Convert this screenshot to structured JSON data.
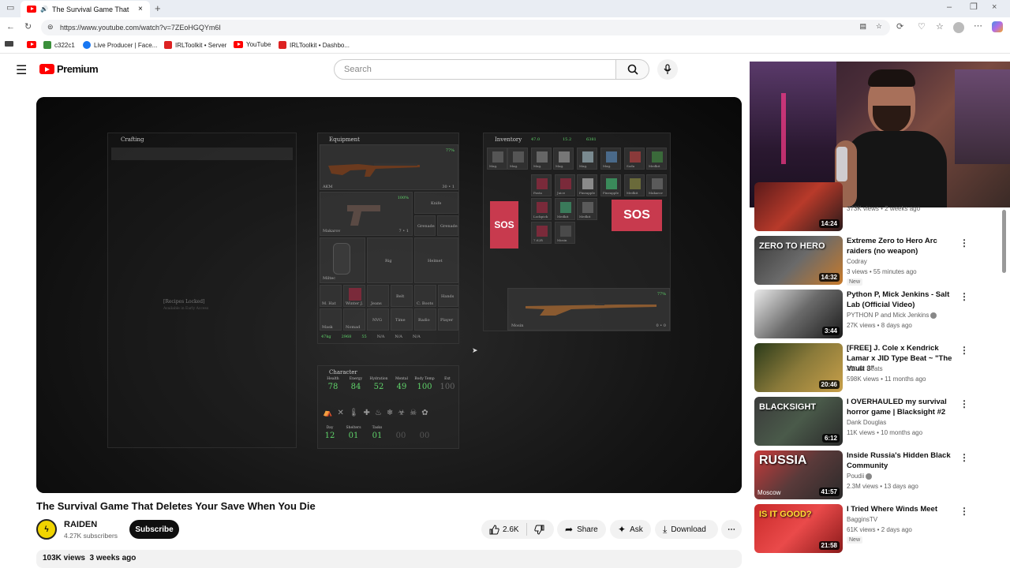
{
  "browser": {
    "tab_title": "The Survival Game That Dele",
    "url": "https://www.youtube.com/watch?v=7ZEoHGQYm6I",
    "bookmarks": [
      "c322c1",
      "Live Producer | Face...",
      "IRLToolkit • Server",
      "YouTube",
      "IRLToolkit • Dashbo..."
    ]
  },
  "header": {
    "logo_text": "Premium",
    "search_placeholder": "Search"
  },
  "game": {
    "crafting_title": "Crafting",
    "recipes_locked": "[Recipes Locked]",
    "recipes_sub": "Available in Early Access",
    "equipment_title": "Equipment",
    "inventory_title": "Inventory",
    "character_title": "Character",
    "inventory_stats": [
      "47.0",
      "15.2",
      "6381"
    ],
    "weapon_primary": "AKM",
    "weapon_primary_ammo": "30 • 1",
    "weapon_primary_condition": "77%",
    "weapon_secondary": "Makarov",
    "weapon_secondary_ammo": "7 • 1",
    "weapon_secondary_condition": "100%",
    "weapon_inventory": "Mosin",
    "weapon_inventory_ammo": "0 • 0",
    "weapon_inventory_condition": "77%",
    "equipment_slots": [
      "Knife",
      "Grenade",
      "Grenade",
      "Rig",
      "Helmet",
      "Belt",
      "C. Boots",
      "Hands",
      "NVG",
      "Time",
      "Radio",
      "Player",
      "Jeans",
      "Winter J.",
      "M. Hat",
      "Nomad",
      "Mask",
      "Miltec"
    ],
    "equipment_footer": [
      "47kg",
      "2968",
      "55",
      "N/A",
      "N/A",
      "N/A"
    ],
    "inventory_items": [
      "Mag.",
      "Mag.",
      "Mag.",
      "Mag.",
      "Mag.",
      "Mag.",
      "Soda",
      "Medkit",
      "Pasta",
      "Juice",
      "Pineapple",
      "Pineapple",
      "Medkit",
      "Makarov",
      "Lockpick",
      "Medkit",
      "Medkit",
      "7.62R",
      "Mosin"
    ],
    "character_stats": [
      {
        "label": "Health",
        "value": "78"
      },
      {
        "label": "Energy",
        "value": "84"
      },
      {
        "label": "Hydration",
        "value": "52"
      },
      {
        "label": "Mental",
        "value": "49"
      },
      {
        "label": "Body Temp",
        "value": "100"
      },
      {
        "label": "Ext",
        "value": "100"
      }
    ],
    "character_counters": [
      {
        "label": "Day",
        "value": "12"
      },
      {
        "label": "Shelters",
        "value": "01"
      },
      {
        "label": "Tasks",
        "value": "01"
      },
      {
        "label": "",
        "value": "00"
      },
      {
        "label": "",
        "value": "00"
      }
    ],
    "sos_label": "SOS"
  },
  "video": {
    "title": "The Survival Game That Deletes Your Save When You Die",
    "channel": "RAIDEN",
    "subscribers": "4.27K subscribers",
    "subscribe_label": "Subscribe",
    "likes": "2.6K",
    "share_label": "Share",
    "ask_label": "Ask",
    "download_label": "Download",
    "views_date": "103K views  3 weeks ago"
  },
  "sidebar": {
    "partial_meta": "373K views • 2 weeks ago",
    "partial_duration": "14:24",
    "items": [
      {
        "title": "Extreme Zero to Hero Arc raiders (no weapon)",
        "channel": "Codray",
        "meta": "3 views • 55 minutes ago",
        "badge": "New",
        "duration": "14:32",
        "thumb_text": "ZERO TO HERO",
        "verified": false
      },
      {
        "title": "Python P, Mick Jenkins - Salt Lab (Official Video)",
        "channel": "PYTHON P and Mick Jenkins",
        "meta": "27K views • 8 days ago",
        "badge": "",
        "duration": "3:44",
        "thumb_text": "",
        "verified": true
      },
      {
        "title": "[FREE] J. Cole x Kendrick Lamar x JID Type Beat ~ \"The Vault 3\"",
        "channel": "ARVM Beats",
        "meta": "598K views • 11 months ago",
        "badge": "",
        "duration": "20:46",
        "thumb_text": "",
        "verified": false
      },
      {
        "title": "I OVERHAULED my survival horror game | Blacksight #2",
        "channel": "Dank Douglas",
        "meta": "11K views • 10 months ago",
        "badge": "",
        "duration": "6:12",
        "thumb_text": "BLACKSIGHT",
        "verified": false
      },
      {
        "title": "Inside Russia's Hidden Black Community",
        "channel": "Poudii",
        "meta": "2.3M views • 13 days ago",
        "badge": "",
        "duration": "41:57",
        "thumb_text": "RUSSIA",
        "thumb_sub": "Moscow",
        "verified": true
      },
      {
        "title": "I Tried Where Winds Meet",
        "channel": "BagginsTV",
        "meta": "61K views • 2 days ago",
        "badge": "New",
        "duration": "21:58",
        "thumb_text": "IS IT GOOD?",
        "verified": false
      }
    ]
  },
  "colors": {
    "yt_red": "#ff0000",
    "stat_green": "#5fd36a",
    "sos_red": "#c83a4e"
  }
}
